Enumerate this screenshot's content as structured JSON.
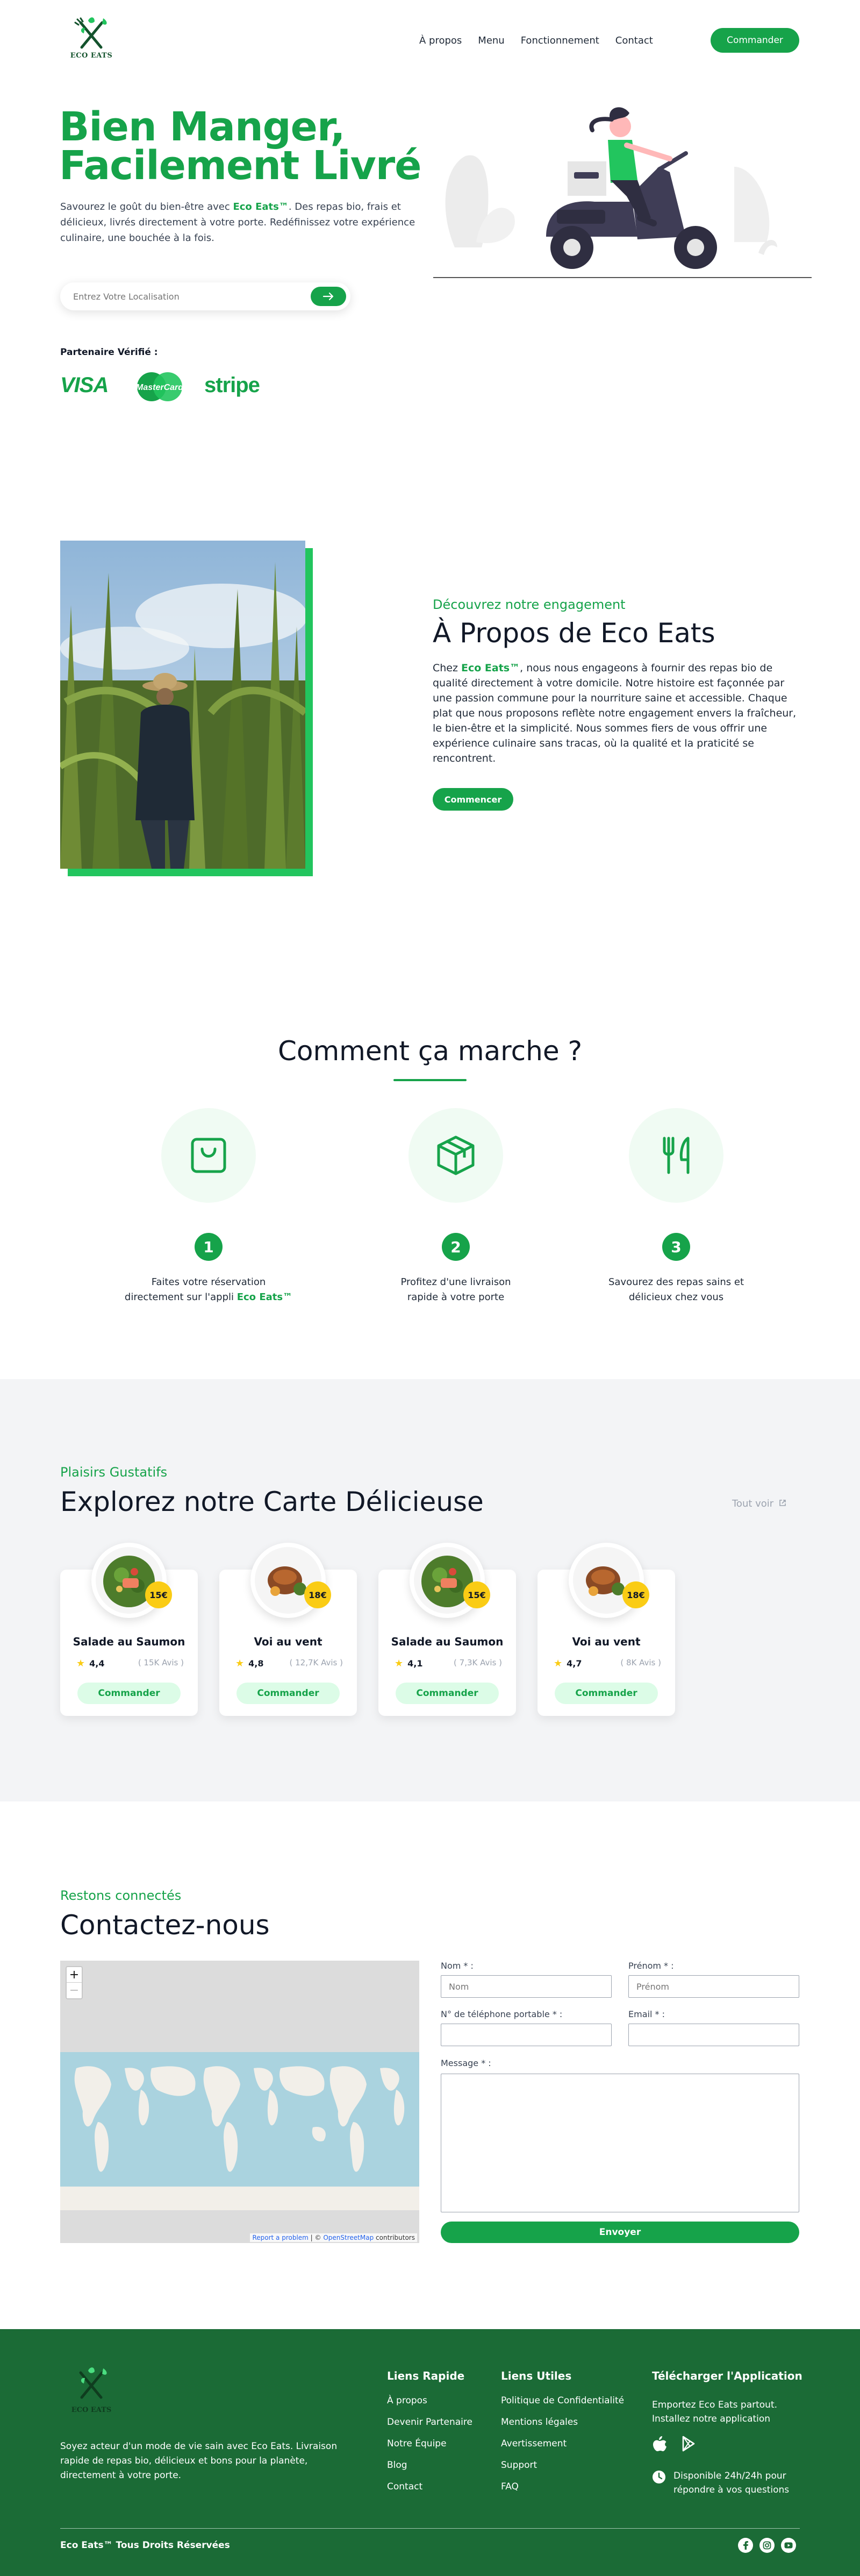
{
  "brand": {
    "name": "ECO EATS",
    "primary": "#16a34a",
    "footer_bg": "#1b6b36",
    "accent": "#facc15"
  },
  "nav": {
    "items": [
      {
        "label": "À propos"
      },
      {
        "label": "Menu"
      },
      {
        "label": "Fonctionnement"
      },
      {
        "label": "Contact"
      }
    ],
    "order_button": "Commander"
  },
  "hero": {
    "title_line1": "Bien Manger,",
    "title_line2": "Facilement Livré",
    "desc_before": "Savourez le goût du bien-être avec ",
    "desc_brand": "Eco Eats™",
    "desc_after": ". Des repas bio, frais et délicieux, livrés directement à votre porte. Redéfinissez votre expérience culinaire, une bouchée à la fois.",
    "search_placeholder": "Entrez Votre Localisation",
    "partner_label": "Partenaire Vérifié :",
    "partners": [
      "VISA",
      "MasterCard",
      "stripe"
    ]
  },
  "about": {
    "kicker": "Découvrez notre engagement",
    "title": "À Propos de Eco Eats",
    "text_before": "Chez ",
    "text_brand": "Eco Eats™",
    "text_after": ", nous nous engageons à fournir des repas bio de qualité directement à votre domicile. Notre histoire est façonnée par une passion commune pour la nourriture saine et accessible. Chaque plat que nous proposons reflète notre engagement envers la fraîcheur, le bien-être et la simplicité. Nous sommes fiers de vous offrir une expérience culinaire sans tracas, où la qualité et la praticité se rencontrent.",
    "button": "Commencer"
  },
  "how": {
    "title": "Comment ça marche ?",
    "steps": [
      {
        "num": "1",
        "icon": "shopping-bag-icon",
        "line1": "Faites votre réservation",
        "line2_before": "directement sur l'appli ",
        "line2_brand": "Eco Eats™"
      },
      {
        "num": "2",
        "icon": "package-box-icon",
        "line1": "Profitez d'une livraison",
        "line2_before": "rapide à votre porte",
        "line2_brand": ""
      },
      {
        "num": "3",
        "icon": "utensils-icon",
        "line1": "Savourez des repas sains et",
        "line2_before": "délicieux chez vous",
        "line2_brand": ""
      }
    ]
  },
  "menu": {
    "kicker": "Plaisirs Gustatifs",
    "title": "Explorez notre Carte Délicieuse",
    "see_all": "Tout voir",
    "cards": [
      {
        "name": "Salade au Saumon",
        "price": "15€",
        "rating": "4,4",
        "reviews": "( 15K Avis )",
        "button": "Commander"
      },
      {
        "name": "Voi au vent",
        "price": "18€",
        "rating": "4,8",
        "reviews": "( 12,7K Avis )",
        "button": "Commander"
      },
      {
        "name": "Salade au Saumon",
        "price": "15€",
        "rating": "4,1",
        "reviews": "( 7,3K Avis )",
        "button": "Commander"
      },
      {
        "name": "Voi au vent",
        "price": "18€",
        "rating": "4,7",
        "reviews": "( 8K Avis )",
        "button": "Commander"
      }
    ]
  },
  "contact": {
    "kicker": "Restons connectés",
    "title": "Contactez-nous",
    "map_zoom_in": "+",
    "map_zoom_out": "−",
    "map_attr_link": "Report a problem",
    "map_attr_sep": " | © ",
    "map_attr_osm": "OpenStreetMap",
    "map_attr_end": " contributors",
    "fields": {
      "nom_label": "Nom * :",
      "nom_placeholder": "Nom",
      "prenom_label": "Prénom * :",
      "prenom_placeholder": "Prénom",
      "tel_label": "N° de téléphone portable * :",
      "email_label": "Email * :",
      "message_label": "Message * :"
    },
    "submit": "Envoyer"
  },
  "footer": {
    "logo_text": "ECO EATS",
    "desc": "Soyez acteur d'un mode de vie sain avec Eco Eats. Livraison rapide de repas bio, délicieux et bons pour la planète, directement à votre porte.",
    "quick_title": "Liens Rapide",
    "quick_links": [
      "À propos",
      "Devenir Partenaire",
      "Notre Équipe",
      "Blog",
      "Contact"
    ],
    "useful_title": "Liens Utiles",
    "useful_links": [
      "Politique de Confidentialité",
      "Mentions légales",
      "Avertissement",
      "Support",
      "FAQ"
    ],
    "app_title": "Télécharger l'Application",
    "app_text": "Emportez Eco Eats partout. Installez notre application",
    "availability": "Disponible 24h/24h pour répondre à vos questions",
    "copyright": "Eco Eats™ Tous Droits Réservées"
  }
}
